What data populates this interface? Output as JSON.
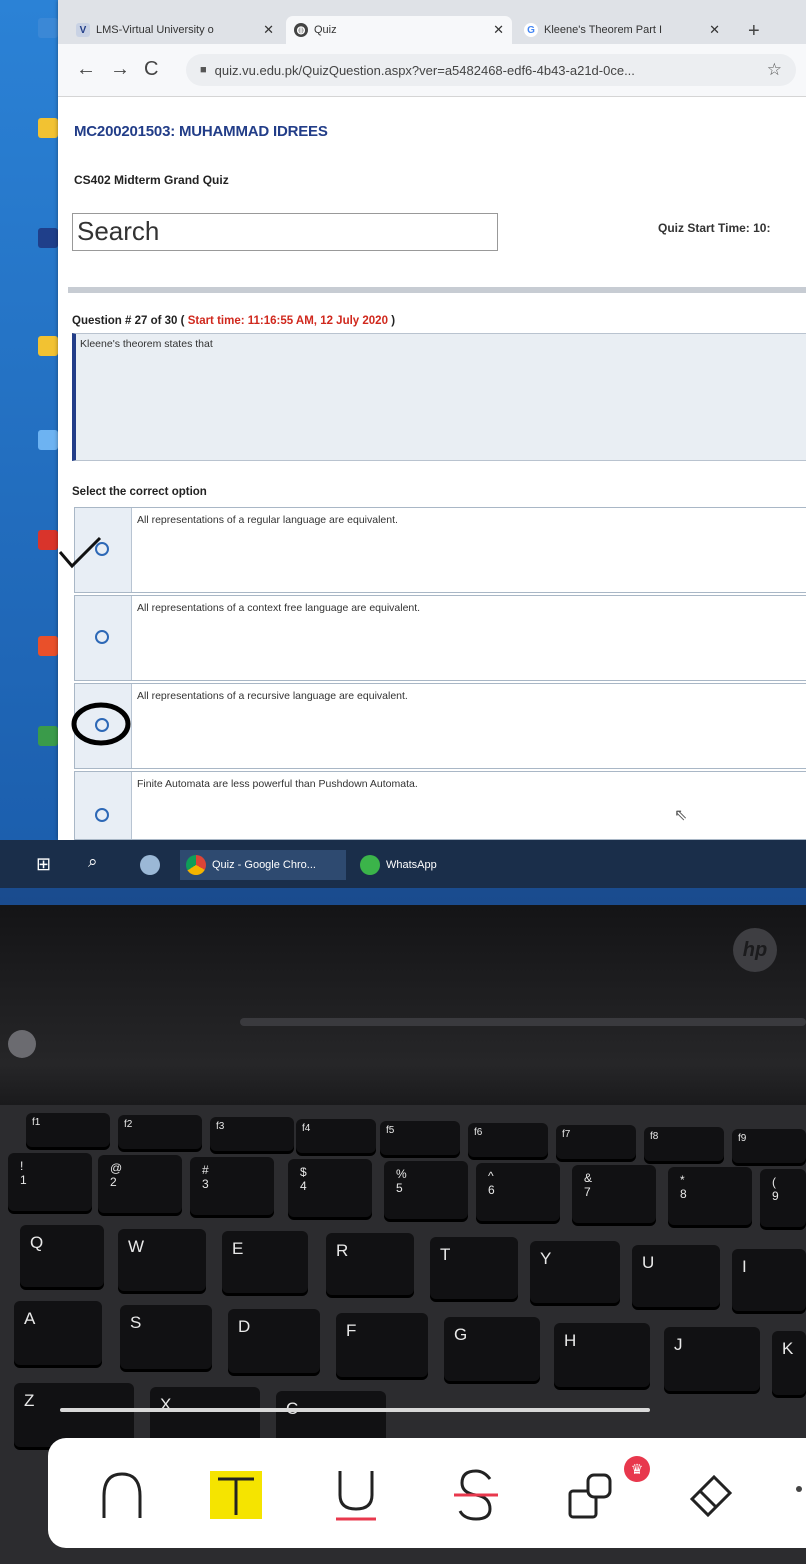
{
  "browser": {
    "tabs": [
      {
        "label": "LMS-Virtual University o",
        "icon": "vu-logo-icon"
      },
      {
        "label": "Quiz",
        "icon": "globe-icon"
      },
      {
        "label": "Kleene's Theorem Part I",
        "icon": "google-icon"
      }
    ],
    "url": "quiz.vu.edu.pk/QuizQuestion.aspx?ver=a5482468-edf6-4b43-a21d-0ce..."
  },
  "page": {
    "student": "MC200201503: MUHAMMAD IDREES",
    "course": "CS402 Midterm Grand Quiz",
    "search_label": "Search",
    "quiz_start_time": "Quiz Start Time: 10:",
    "question_header": "Question # 27 of 30 (",
    "question_start_time": "Start time: 11:16:55 AM, 12 July 2020",
    "question_header_end": ")",
    "question_text": "Kleene's theorem states that",
    "select_label": "Select the correct option",
    "options": [
      "All representations of a regular language are equivalent.",
      "All representations of a context free language are equivalent.",
      "All representations of a recursive language are equivalent.",
      "Finite Automata are less powerful than Pushdown Automata."
    ]
  },
  "taskbar": {
    "chrome_label": "Quiz - Google Chro...",
    "whatsapp_label": "WhatsApp"
  },
  "laptop": {
    "logo": "hp",
    "fn_keys": [
      "f1",
      "f2",
      "f3",
      "f4",
      "f5",
      "f6",
      "f7",
      "f8",
      "f9"
    ],
    "number_keys": [
      [
        "!",
        "1"
      ],
      [
        "@",
        "2"
      ],
      [
        "#",
        "3"
      ],
      [
        "$",
        "4"
      ],
      [
        "%",
        "5"
      ],
      [
        "^",
        "6"
      ],
      [
        "&",
        "7"
      ],
      [
        "*",
        "8"
      ],
      [
        "(",
        "9"
      ]
    ],
    "letter_row_1": [
      "Q",
      "W",
      "E",
      "R",
      "T",
      "Y",
      "U",
      "I"
    ],
    "letter_row_2": [
      "A",
      "S",
      "D",
      "F",
      "G",
      "H",
      "J",
      "K"
    ],
    "letter_row_3": [
      "Z",
      "X",
      "C"
    ]
  },
  "annotation_tools": [
    "pen-tool-icon",
    "text-highlight-icon",
    "underline-icon",
    "strikethrough-icon",
    "shapes-icon",
    "eraser-icon"
  ],
  "colors": {
    "accent_blue": "#223d88",
    "start_time_red": "#d0281d",
    "highlight_yellow": "#f5e400",
    "underline_red": "#e8384d"
  }
}
